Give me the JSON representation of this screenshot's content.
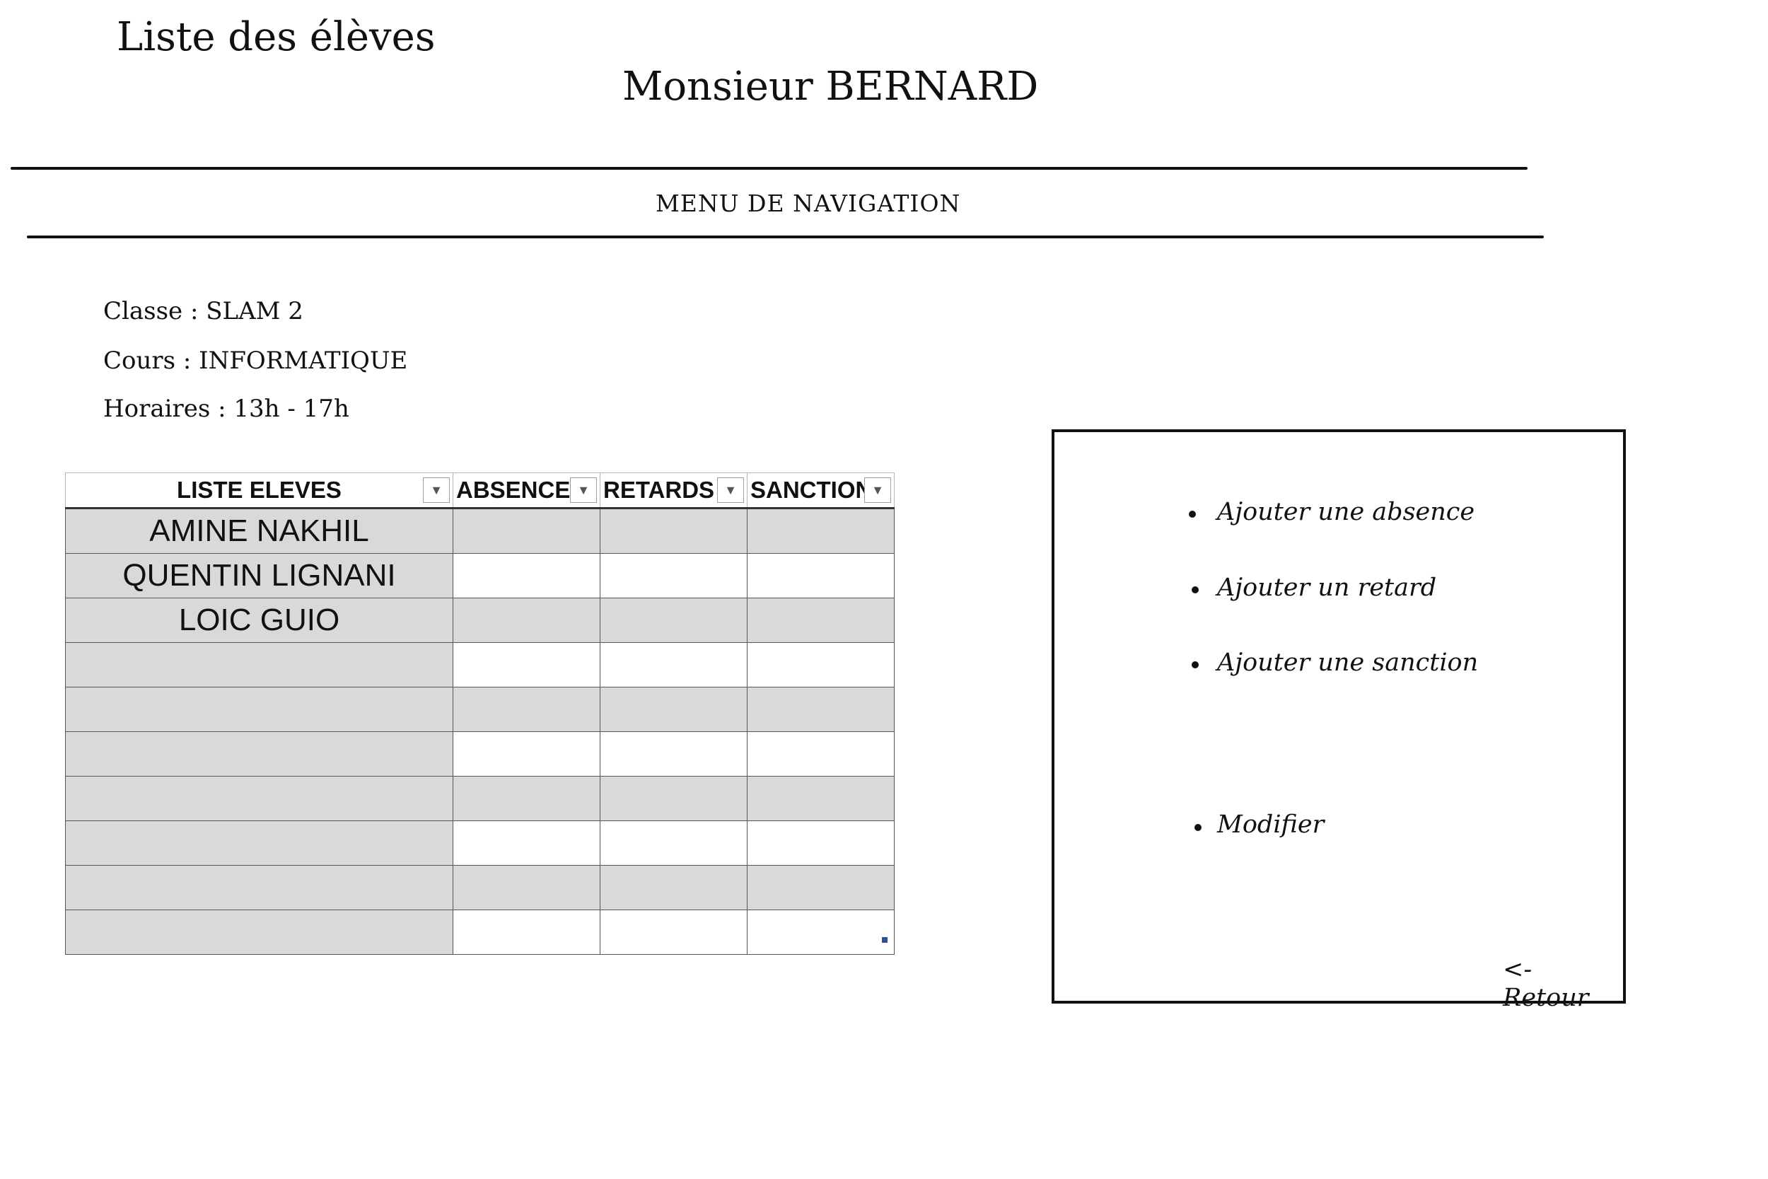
{
  "header": {
    "page_title": "Liste des élèves",
    "teacher_name": "Monsieur BERNARD",
    "nav_menu_label": "MENU DE NAVIGATION"
  },
  "info": {
    "classe": "Classe : SLAM 2",
    "cours": "Cours : INFORMATIQUE",
    "horaires": "Horaires : 13h - 17h"
  },
  "table": {
    "columns": [
      "LISTE ELEVES",
      "ABSENCES",
      "RETARDS",
      "SANCTION"
    ],
    "rows": [
      {
        "name": "AMINE NAKHIL",
        "absences": "",
        "retards": "",
        "sanction": ""
      },
      {
        "name": "QUENTIN LIGNANI",
        "absences": "",
        "retards": "",
        "sanction": ""
      },
      {
        "name": "LOIC GUIO",
        "absences": "",
        "retards": "",
        "sanction": ""
      },
      {
        "name": "",
        "absences": "",
        "retards": "",
        "sanction": ""
      },
      {
        "name": "",
        "absences": "",
        "retards": "",
        "sanction": ""
      },
      {
        "name": "",
        "absences": "",
        "retards": "",
        "sanction": ""
      },
      {
        "name": "",
        "absences": "",
        "retards": "",
        "sanction": ""
      },
      {
        "name": "",
        "absences": "",
        "retards": "",
        "sanction": ""
      },
      {
        "name": "",
        "absences": "",
        "retards": "",
        "sanction": ""
      },
      {
        "name": "",
        "absences": "",
        "retards": "",
        "sanction": ""
      }
    ]
  },
  "actions_panel": {
    "add_absence": "Ajouter une absence",
    "add_delay": "Ajouter un retard",
    "add_sanction": "Ajouter une sanction",
    "modify": "Modifier",
    "back": "<- Retour"
  }
}
